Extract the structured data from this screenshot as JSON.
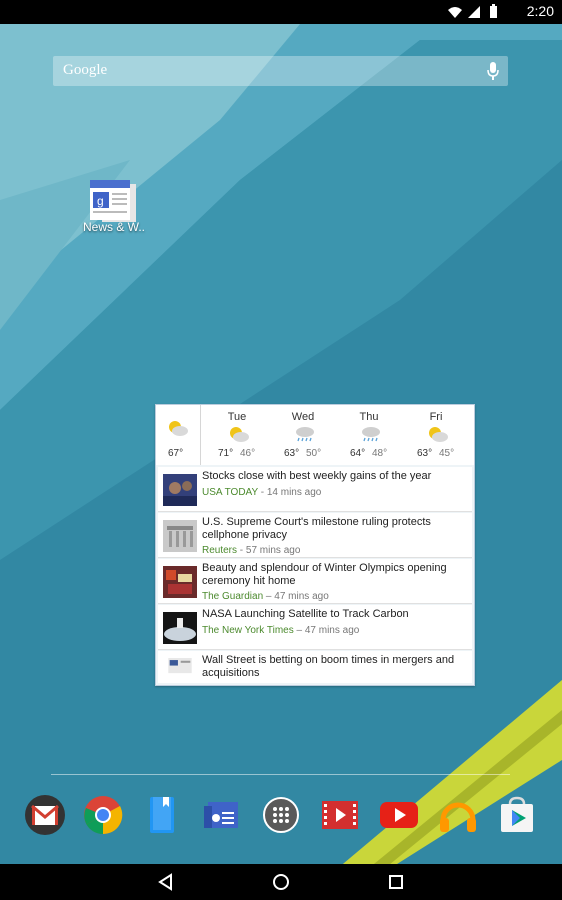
{
  "status_bar": {
    "time": "2:20"
  },
  "search": {
    "logo": "Google",
    "icon": "mic-icon"
  },
  "desktop_app": {
    "label": "News & W..",
    "icon": "news-weather-icon"
  },
  "weather": {
    "current": {
      "temp": "67°",
      "icon": "partly-cloudy-icon"
    },
    "days": [
      {
        "name": "Tue",
        "hi": "71°",
        "lo": "46°",
        "icon": "partly-cloudy-icon"
      },
      {
        "name": "Wed",
        "hi": "63°",
        "lo": "50°",
        "icon": "rain-icon"
      },
      {
        "name": "Thu",
        "hi": "64°",
        "lo": "48°",
        "icon": "rain-icon"
      },
      {
        "name": "Fri",
        "hi": "63°",
        "lo": "45°",
        "icon": "partly-cloudy-icon"
      }
    ]
  },
  "news": [
    {
      "title": "Stocks close with best weekly gains of the year",
      "source": "USA TODAY",
      "time": " - 14 mins ago"
    },
    {
      "title": "U.S. Supreme Court's milestone ruling protects cellphone privacy",
      "source": "Reuters",
      "time": " - 57 mins ago"
    },
    {
      "title": "Beauty and splendour of Winter Olympics opening ceremony hit home",
      "source": "The Guardian",
      "time": " – 47 mins ago"
    },
    {
      "title": "NASA Launching Satellite to Track Carbon",
      "source": "The New York Times",
      "time": " – 47 mins ago"
    },
    {
      "title": "Wall Street is betting on boom times in mergers and acquisitions",
      "source": "",
      "time": ""
    }
  ],
  "dock": [
    {
      "name": "gmail-icon"
    },
    {
      "name": "chrome-icon"
    },
    {
      "name": "play-books-icon"
    },
    {
      "name": "news-weather-icon"
    },
    {
      "name": "app-drawer-icon"
    },
    {
      "name": "play-movies-icon"
    },
    {
      "name": "youtube-icon"
    },
    {
      "name": "play-music-icon"
    },
    {
      "name": "play-store-icon"
    }
  ],
  "colors": {
    "accent_green": "#4c8a2e",
    "wallpaper_blue": "#3f97b3",
    "yellow_stripe": "#c9d63a"
  }
}
